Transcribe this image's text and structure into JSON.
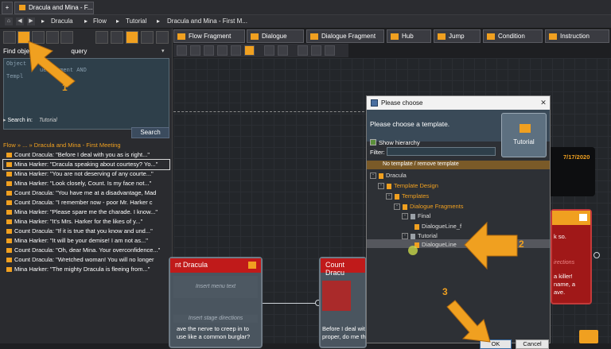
{
  "tabs": {
    "plus": "+",
    "current": "Dracula and Mina - F..."
  },
  "breadcrumb": {
    "items": [
      "Dracula",
      "Flow",
      "Tutorial",
      "Dracula and Mina - First M..."
    ]
  },
  "node_types": [
    "Flow Fragment",
    "Dialogue",
    "Dialogue Fragment",
    "Hub",
    "Jump",
    "Condition",
    "Instruction"
  ],
  "search": {
    "find_label": "Find object",
    "query_label": "query",
    "query_text": "Object\n          ueFragment AND\nTempl",
    "search_in_label": "Search in:",
    "search_in_value": "Tutorial",
    "search_button": "Search"
  },
  "results": {
    "head": "Flow » ... » Dracula and Mina - First Meeting",
    "items": [
      "Count Dracula: \"Before I deal with you as is right...\"",
      "Mina Harker: \"Dracula speaking about courtesy? Yo...\"",
      "Mina Harker: \"You are not deserving of any courte...\"",
      "Mina Harker: \"Look closely, Count. Is my face not...\"",
      "Count Dracula: \"You have me at a disadvantage, Mad",
      "Count Dracula: \"I remember now - poor Mr. Harker c",
      "Mina Harker: \"Please spare me the charade. I know...\"",
      "Mina Harker: \"It's Mrs. Harker for the likes of y...\"",
      "Count Dracula: \"If it is true that you know and und...\"",
      "Mina Harker: \"It will be your demise! I am not as...\"",
      "Count Dracula: \"Oh, dear Mina. Your overconfidence...\"",
      "Count Dracula: \"Wretched woman! You will no longer",
      "Mina Harker: \"The mighty Dracula is fleeing from...\""
    ]
  },
  "dialog": {
    "title": "Please choose",
    "close": "✕",
    "header": "Please choose a template.",
    "preview_label": "Tutorial",
    "show_hierarchy": "Show hierarchy",
    "filter_label": "Filter:",
    "no_template": "No template / remove template",
    "tree": [
      "Dracula",
      "Template Design",
      "Templates",
      "Dialogue Fragments",
      "Final",
      "DialogueLine_f",
      "Tutorial",
      "DialogueLine"
    ],
    "ok": "OK",
    "cancel": "Cancel"
  },
  "canvas": {
    "date": "7/17/2020",
    "node1": {
      "title": "nt Dracula",
      "menu": "Insert menu text",
      "stage": "Insert stage directions",
      "text": "ave the nerve to creep in to\nuse like a common burglar?"
    },
    "node2": {
      "title": "Count Dracu",
      "text": "Before I deal wit\nproper, do me th"
    },
    "node3": {
      "text1": "k so.",
      "dirs": "irections",
      "text2": "a killer!\nname, a\nave."
    }
  },
  "annotations": {
    "one": "1",
    "two": "2",
    "three": "3"
  },
  "colors": {
    "accent": "#f0a020",
    "node_head": "#c01a1a",
    "dialog_header": "#3a4a58"
  }
}
